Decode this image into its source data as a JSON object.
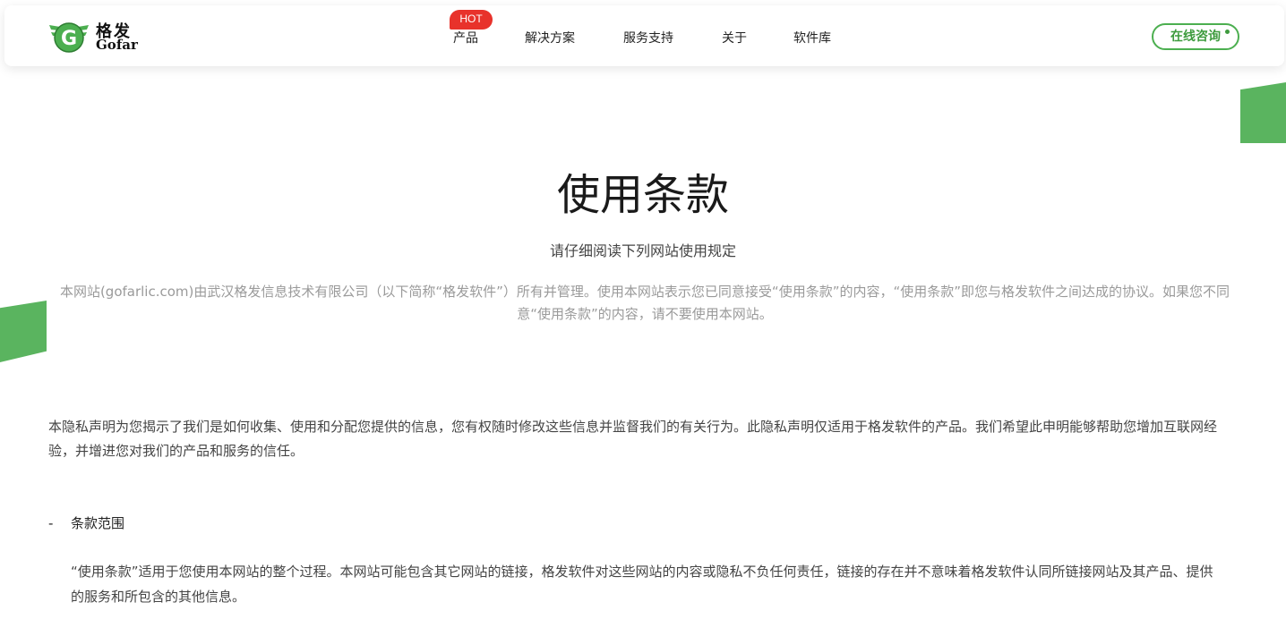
{
  "header": {
    "logo": {
      "cn": "格发",
      "en": "Gofar",
      "letter": "G",
      "colors": {
        "green": "#4caf50",
        "dark_green": "#2e7d32"
      }
    },
    "nav": [
      {
        "label": "产品",
        "badge": "HOT"
      },
      {
        "label": "解决方案"
      },
      {
        "label": "服务支持"
      },
      {
        "label": "关于"
      },
      {
        "label": "软件库"
      }
    ],
    "consult_label": "在线咨询"
  },
  "main": {
    "title": "使用条款",
    "subtitle": "请仔细阅读下列网站使用规定",
    "intro": "本网站(gofarlic.com)由武汉格发信息技术有限公司（以下简称“格发软件”）所有并管理。使用本网站表示您已同意接受“使用条款”的内容，“使用条款”即您与格发软件之间达成的协议。如果您不同意“使用条款”的内容，请不要使用本网站。",
    "privacy": "本隐私声明为您揭示了我们是如何收集、使用和分配您提供的信息，您有权随时修改这些信息并监督我们的有关行为。此隐私声明仅适用于格发软件的产品。我们希望此申明能够帮助您增加互联网经验，并增进您对我们的产品和服务的信任。",
    "section": {
      "dash": "-",
      "heading": "条款范围",
      "body": "“使用条款”适用于您使用本网站的整个过程。本网站可能包含其它网站的链接，格发软件对这些网站的内容或隐私不负任何责任，链接的存在并不意味着格发软件认同所链接网站及其产品、提供的服务和所包含的其他信息。"
    }
  },
  "colors": {
    "accent": "#5ab45f",
    "hot_badge": "#e8322b"
  }
}
